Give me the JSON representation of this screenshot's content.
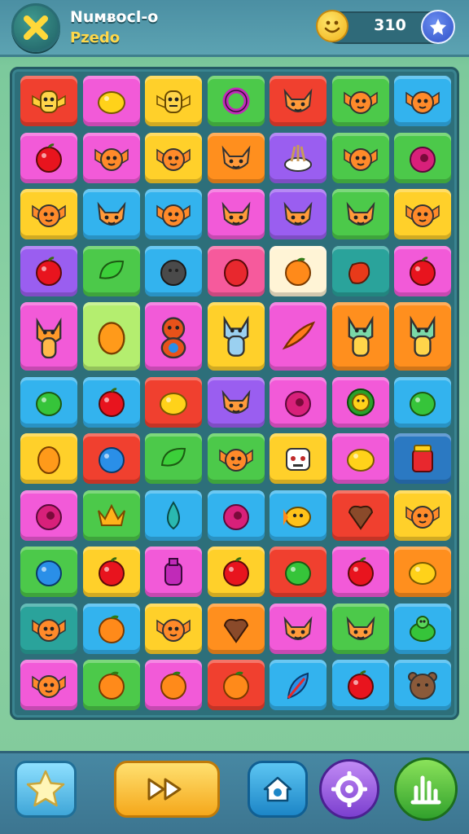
{
  "header": {
    "title": "Nuᴍᴃᴏcl-o",
    "subtitle": "Pzedo",
    "close_icon": "close-x-icon",
    "coin_icon": "smiley-coin-icon",
    "coin_value": "310",
    "plus_icon": "plus-star-icon"
  },
  "colors": {
    "red": "#f0402f",
    "magenta": "#f25ad8",
    "yellow": "#ffd02a",
    "green": "#4cc94a",
    "blue": "#33b3ee",
    "purple": "#9a5ef0",
    "pink": "#f65a9c",
    "orange": "#ff8f1e",
    "teal": "#2aa39b",
    "white": "#fff4d6",
    "lightgreen": "#b4ee6f",
    "darkblue": "#2b79c2"
  },
  "board": {
    "rows": 11,
    "cols": 7,
    "tiles": [
      [
        "red:winged-mask",
        "magenta:lemon",
        "yellow:winged-mask",
        "green:ring",
        "red:cat-face",
        "green:winged-creature",
        "blue:winged-creature"
      ],
      [
        "magenta:apple",
        "magenta:winged-creature",
        "yellow:winged-creature",
        "orange:cat-face",
        "purple:bird-nest",
        "green:winged-creature",
        "green:plum"
      ],
      [
        "yellow:winged-creature",
        "blue:cat-face",
        "blue:winged-creature",
        "magenta:cat-face",
        "purple:cat-face",
        "green:cat-face",
        "yellow:winged-creature"
      ],
      [
        "purple:apple",
        "green:leaf",
        "blue:stone",
        "pink:berry",
        "white:orange",
        "teal:pepper",
        "magenta:apple"
      ],
      [
        "magenta:fox-creature",
        "lightgreen:mango",
        "magenta:bear-creature",
        "yellow:cat-creature",
        "magenta:carrot",
        "orange:lizard-creature",
        "orange:lizard-creature"
      ],
      [
        "blue:lime",
        "blue:apple",
        "red:lemon",
        "purple:cat-face",
        "magenta:plum",
        "magenta:sun-flower",
        "blue:lime"
      ],
      [
        "yellow:mango",
        "red:blueberry",
        "green:leaf",
        "green:winged-creature",
        "yellow:robot-face",
        "magenta:lemon",
        "darkblue:jar"
      ],
      [
        "magenta:plum",
        "green:crown-leaf",
        "blue:leaf-drop",
        "blue:plum",
        "blue:fish-face",
        "red:heart-nut",
        "yellow:winged-creature"
      ],
      [
        "green:blueberry",
        "yellow:apple",
        "magenta:bottle",
        "yellow:apple",
        "red:lime",
        "magenta:apple",
        "orange:lemon"
      ],
      [
        "teal:winged-creature",
        "blue:orange",
        "yellow:winged-creature",
        "orange:heart-nut",
        "magenta:cat-face",
        "green:cat-face",
        "blue:turtle"
      ],
      [
        "magenta:winged-creature",
        "green:orange",
        "magenta:orange",
        "red:orange",
        "blue:feather",
        "blue:apple",
        "blue:bear-face"
      ]
    ]
  },
  "toolbar": {
    "star_icon": "star-icon",
    "play_icon": "fast-forward-icon",
    "home_icon": "home-icon",
    "settings_icon": "settings-icon",
    "leaderboard_icon": "leaderboard-icon"
  }
}
